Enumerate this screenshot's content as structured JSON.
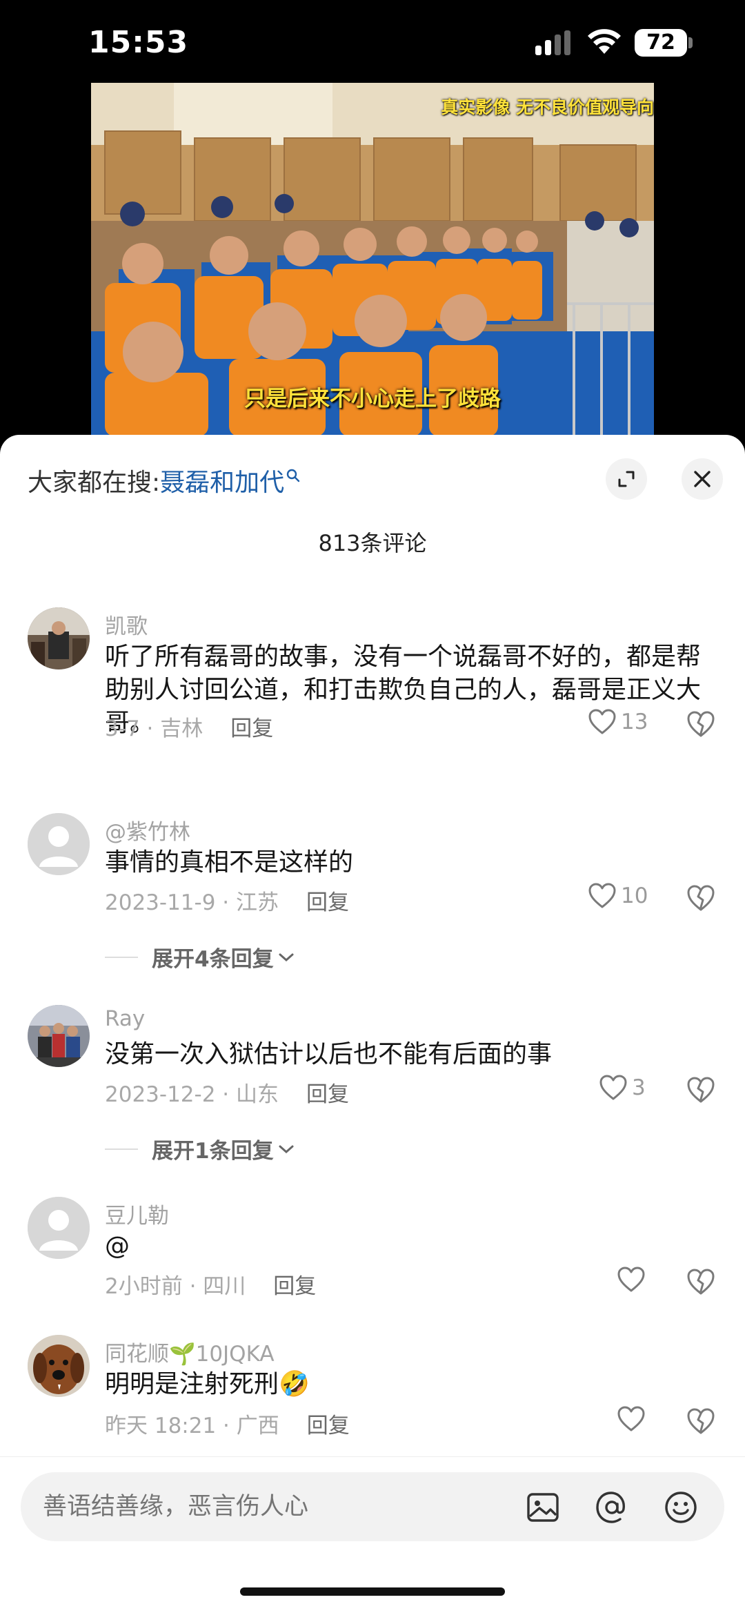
{
  "status_bar": {
    "time": "15:53",
    "battery": "72"
  },
  "video": {
    "caption_top": "真实影像 无不良价值观导向",
    "subtitle": "只是后来不小心走上了歧路"
  },
  "sheet": {
    "search_prefix": "大家都在搜:",
    "search_term": "聂磊和加代",
    "comment_count": "813条评论"
  },
  "comments": [
    {
      "username": "凯歌",
      "text": "听了所有磊哥的故事，没有一个说磊哥不好的，都是帮助别人讨回公道，和打击欺负自己的人，磊哥是正义大哥。",
      "meta": "3-7 · 吉林",
      "reply_label": "回复",
      "likes": "13",
      "avatar": "photo"
    },
    {
      "username": "@紫竹林",
      "text": "事情的真相不是这样的",
      "meta": "2023-11-9 · 江苏",
      "reply_label": "回复",
      "likes": "10",
      "avatar": "default",
      "expand_label": "展开4条回复"
    },
    {
      "username": "Ray",
      "text": "没第一次入狱估计以后也不能有后面的事",
      "meta": "2023-12-2 · 山东",
      "reply_label": "回复",
      "likes": "3",
      "avatar": "group-photo",
      "expand_label": "展开1条回复"
    },
    {
      "username": "豆儿勒",
      "text": "@",
      "meta": "2小时前 · 四川",
      "reply_label": "回复",
      "likes": "",
      "avatar": "default"
    },
    {
      "username": "同花顺🌱10JQKA",
      "text": "明明是注射死刑🤣",
      "meta": "昨天 18:21 · 广西",
      "reply_label": "回复",
      "likes": "",
      "avatar": "dog-photo"
    }
  ],
  "input": {
    "placeholder": "善语结善缘，恶言伤人心"
  },
  "icons": {
    "expand": "expand-icon",
    "close": "close-icon",
    "like": "heart-icon",
    "dislike": "broken-heart-icon",
    "image": "image-icon",
    "mention": "at-icon",
    "emoji": "emoji-icon"
  },
  "colors": {
    "link": "#1f5fa8",
    "caption": "#ffe23a",
    "muted": "#a8a8a8"
  }
}
